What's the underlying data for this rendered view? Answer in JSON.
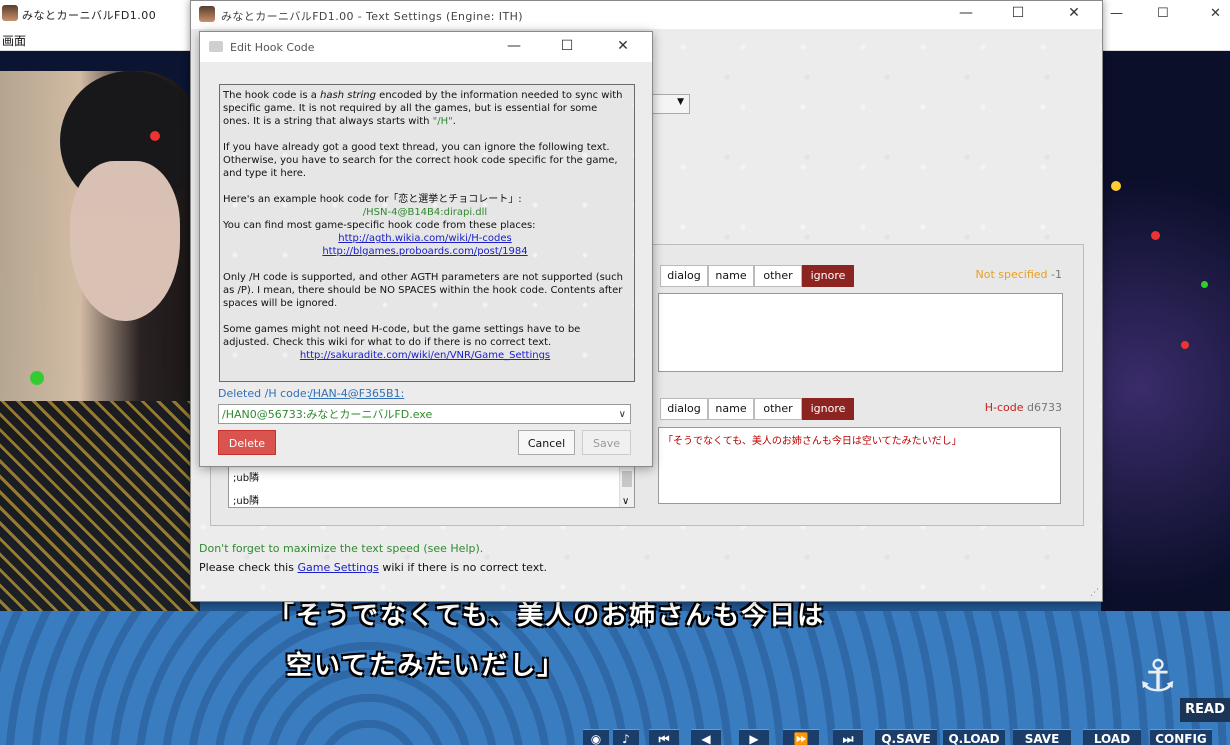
{
  "game": {
    "window_title": "みなとカーニバルFD1.00",
    "menu_item": "画面",
    "dialog_line1": "「そうでなくても、美人のお姉さんも今日は",
    "dialog_line2": "空いてたみたいだし」",
    "read_label": "READ",
    "toolbar": [
      "Q.SAVE",
      "Q.LOAD",
      "SAVE",
      "LOAD",
      "CONFIG"
    ]
  },
  "settings": {
    "window_title": "みなとカーニバルFD1.00 - Text Settings (Engine: ITH)",
    "thread1": {
      "roles": [
        "dialog",
        "name",
        "other",
        "ignore"
      ],
      "status_label": "Not specified",
      "status_value": "-1",
      "text": ""
    },
    "thread2": {
      "roles": [
        "dialog",
        "name",
        "other",
        "ignore"
      ],
      "status_label": "H-code",
      "status_value": "d6733",
      "text": "「そうでなくても、美人のお姉さんも今日は空いてたみたいだし」"
    },
    "list_items": [
      ";ub隣",
      ";ub隣"
    ],
    "hint_green": "Don't forget to maximize the text speed (see Help).",
    "hint_prefix": "Please check this ",
    "hint_link": "Game Settings",
    "hint_suffix": " wiki if there is no correct text."
  },
  "hook_dialog": {
    "title": "Edit Hook Code",
    "p1_a": "The hook code is a ",
    "p1_em": "hash string",
    "p1_b": " encoded by the information needed to sync with specific game. It is not required by all the games, but is essential for some ones. It is a string that always starts with ",
    "p1_code": "\"/H\"",
    "p1_end": ".",
    "p2": "If you have already got a good text thread, you can ignore the following text. Otherwise, you have to search for the correct hook code specific for the game, and type it here.",
    "p3": "Here's an example hook code for「恋と選挙とチョコレート」:",
    "example_code": "/HSN-4@B14B4:dirapi.dll",
    "p4": "You can find most game-specific hook code from these places:",
    "link1": "http://agth.wikia.com/wiki/H-codes",
    "link2": "http://blgames.proboards.com/post/1984",
    "p5": "Only /H code is supported, and other AGTH parameters are not supported (such as /P). I mean, there should be NO SPACES within the hook code. Contents after spaces will be ignored.",
    "p6": "Some games might not need H-code, but the game settings have to be adjusted. Check this wiki for what to do if there is no correct text.",
    "link3": "http://sakuradite.com/wiki/en/VNR/Game_Settings",
    "deleted_label": "Deleted /H code:",
    "deleted_code": "/HAN-4@F365B1:",
    "hook_value": "/HAN0@56733:みなとカーニバルFD.exe",
    "delete_label": "Delete",
    "cancel_label": "Cancel",
    "save_label": "Save"
  }
}
